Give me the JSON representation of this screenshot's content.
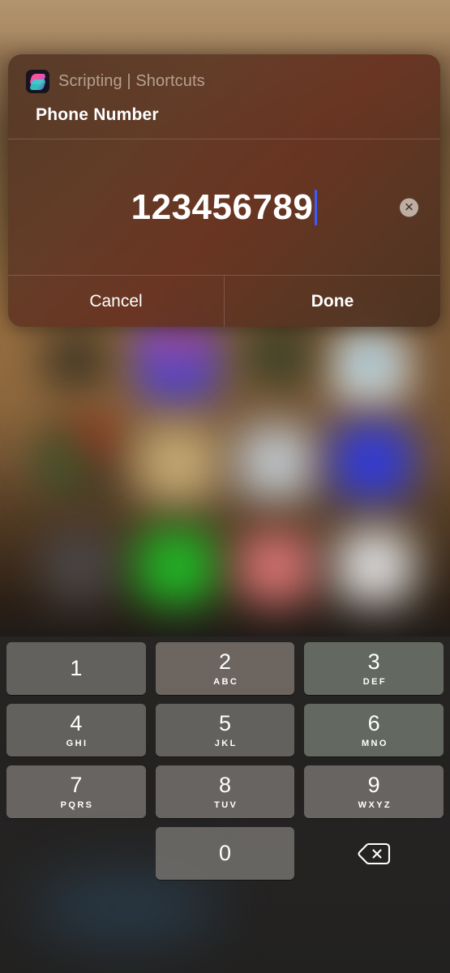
{
  "dialog": {
    "app_icon": "shortcuts-app-icon",
    "app_name": "Scripting | Shortcuts",
    "title": "Phone Number",
    "input": {
      "value": "123456789",
      "placeholder": "",
      "clear_icon": "clear-circle-x-icon",
      "caret_color": "#3f5bff"
    },
    "buttons": {
      "cancel": "Cancel",
      "done": "Done"
    }
  },
  "keypad": {
    "rows": [
      [
        {
          "digit": "1",
          "letters": ""
        },
        {
          "digit": "2",
          "letters": "ABC"
        },
        {
          "digit": "3",
          "letters": "DEF"
        }
      ],
      [
        {
          "digit": "4",
          "letters": "GHI"
        },
        {
          "digit": "5",
          "letters": "JKL"
        },
        {
          "digit": "6",
          "letters": "MNO"
        }
      ],
      [
        {
          "digit": "7",
          "letters": "PQRS"
        },
        {
          "digit": "8",
          "letters": "TUV"
        },
        {
          "digit": "9",
          "letters": "WXYZ"
        }
      ],
      [
        {
          "digit": "",
          "letters": ""
        },
        {
          "digit": "0",
          "letters": ""
        },
        {
          "digit": "",
          "letters": "",
          "icon": "backspace-delete-icon"
        }
      ]
    ]
  },
  "colors": {
    "caret": "#3f5bff",
    "key_face": "#807c76",
    "dialog_tint": "#5c3a26",
    "keyboard_bg": "#232221"
  }
}
